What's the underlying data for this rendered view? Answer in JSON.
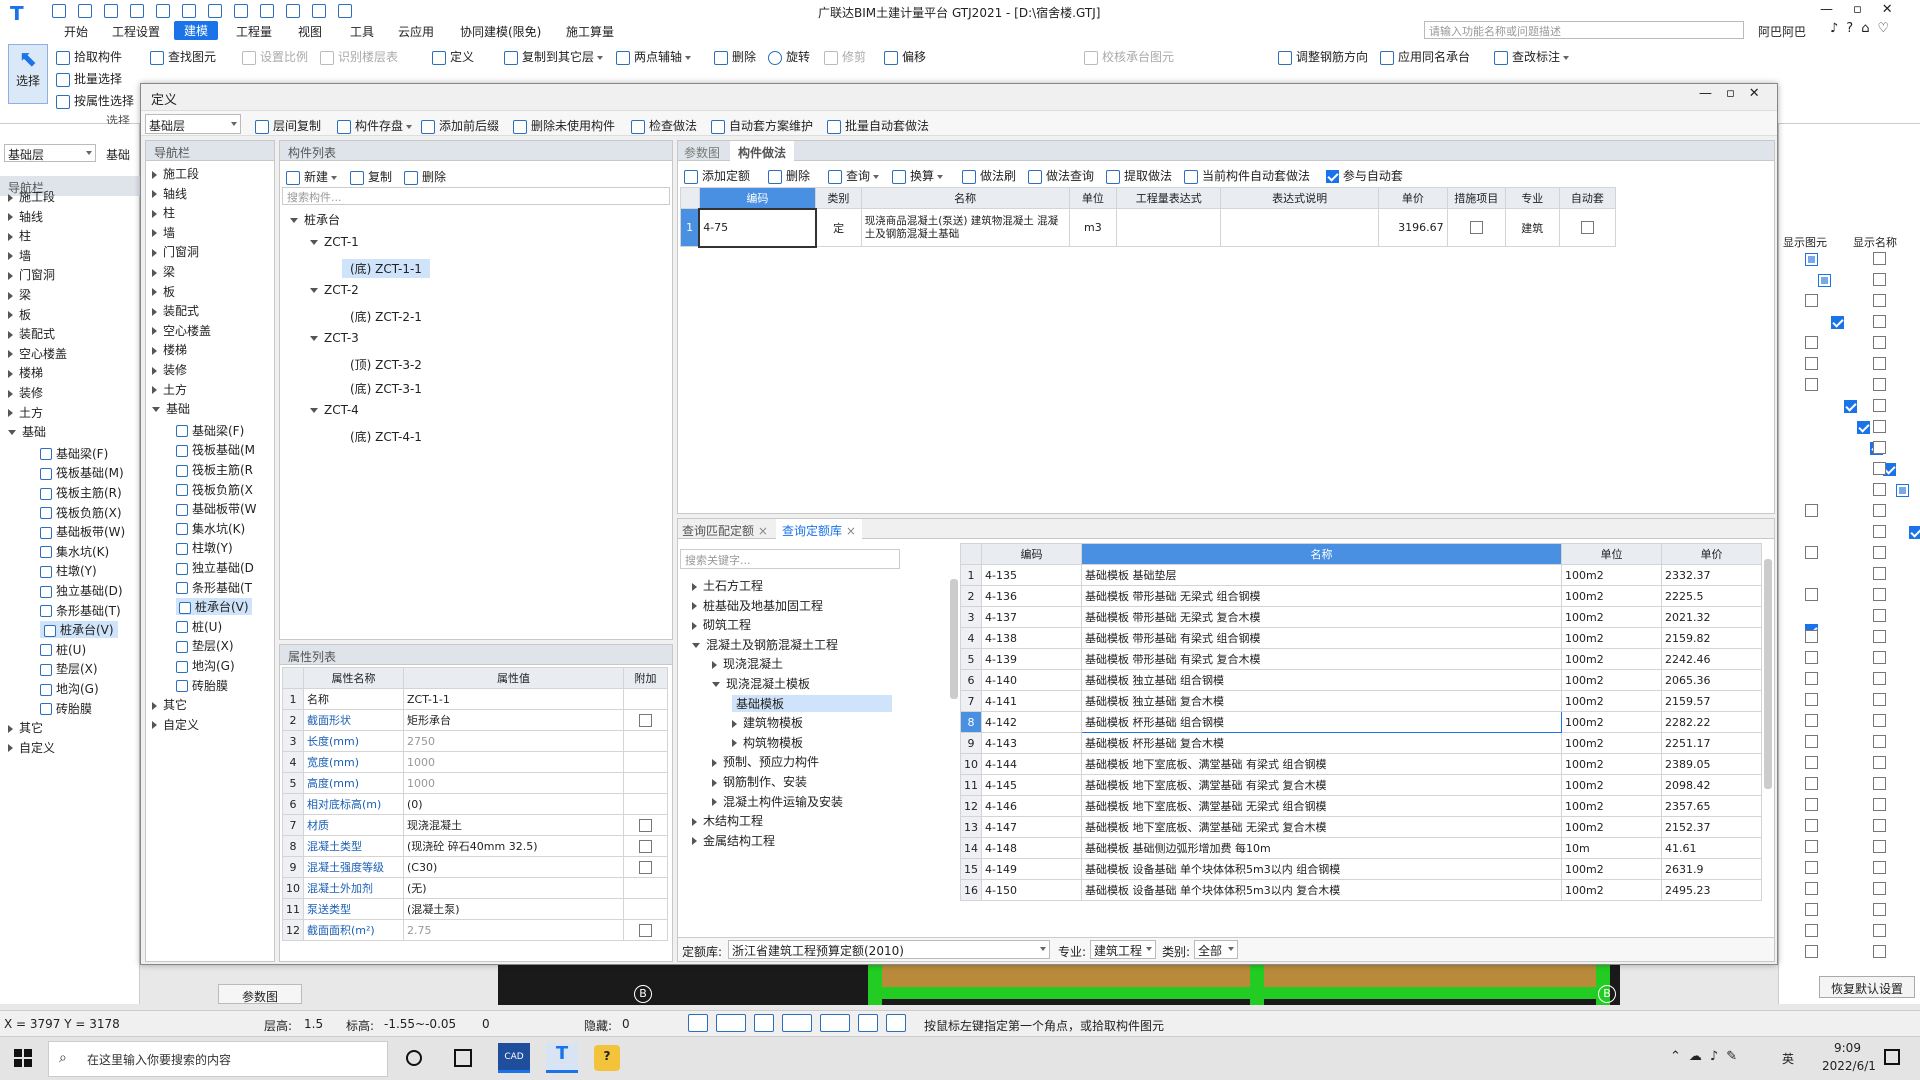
{
  "app": {
    "title": "广联达BIM土建计量平台 GTJ2021 - [D:\\宿舍楼.GTJ]",
    "search_placeholder": "请输入功能名称或问题描述",
    "user": "阿巴阿巴"
  },
  "menu": [
    "开始",
    "工程设置",
    "建模",
    "工程量",
    "视图",
    "工具",
    "云应用",
    "协同建模(限免)",
    "施工算量"
  ],
  "ribbon": {
    "select": "选择",
    "pick": "拾取构件",
    "batch": "批量选择",
    "byattr": "按属性选择",
    "find": "查找图元",
    "setscale": "设置比例",
    "idlayer": "识别楼层表",
    "define": "定义",
    "copyto": "复制到其它层",
    "twopoint": "两点辅轴",
    "delete": "删除",
    "rotate": "旋转",
    "trim": "修剪",
    "offset": "偏移",
    "checkcap": "校核承台图元",
    "adjustbar": "调整钢筋方向",
    "applysame": "应用同名承台",
    "viewmark": "查改标注",
    "group": "选择"
  },
  "left": {
    "floor": "基础层",
    "tab": "基础",
    "nav": "导航栏",
    "items": [
      "施工段",
      "轴线",
      "柱",
      "墙",
      "门窗洞",
      "梁",
      "板",
      "装配式",
      "空心楼盖",
      "楼梯",
      "装修",
      "土方",
      "基础"
    ],
    "subitems": [
      "基础梁(F)",
      "筏板基础(M)",
      "筏板主筋(R)",
      "筏板负筋(X)",
      "基础板带(W)",
      "集水坑(K)",
      "柱墩(Y)",
      "独立基础(D)",
      "条形基础(T)",
      "桩承台(V)",
      "桩(U)",
      "垫层(X)",
      "地沟(G)",
      "砖胎膜"
    ],
    "tail": [
      "其它",
      "自定义"
    ]
  },
  "dialog": {
    "title": "定义",
    "floor": "基础层",
    "toolbar": [
      "层间复制",
      "构件存盘",
      "添加前后缀",
      "删除未使用构件",
      "检查做法",
      "自动套方案维护",
      "批量自动套做法"
    ],
    "nav_title": "导航栏",
    "nav_items": [
      "施工段",
      "轴线",
      "柱",
      "墙",
      "门窗洞",
      "梁",
      "板",
      "装配式",
      "空心楼盖",
      "楼梯",
      "装修",
      "土方",
      "基础"
    ],
    "nav_sub": [
      "基础梁(F)",
      "筏板基础(M",
      "筏板主筋(R",
      "筏板负筋(X",
      "基础板带(W",
      "集水坑(K)",
      "柱墩(Y)",
      "独立基础(D",
      "条形基础(T",
      "桩承台(V)",
      "桩(U)",
      "垫层(X)",
      "地沟(G)",
      "砖胎膜"
    ],
    "nav_tail": [
      "其它",
      "自定义"
    ],
    "complist_title": "构件列表",
    "comp_new": "新建",
    "comp_copy": "复制",
    "comp_del": "删除",
    "comp_search": "搜索构件...",
    "tree": {
      "root": "桩承台",
      "groups": [
        {
          "name": "ZCT-1",
          "children": [
            "(底) ZCT-1-1"
          ]
        },
        {
          "name": "ZCT-2",
          "children": [
            "(底) ZCT-2-1"
          ]
        },
        {
          "name": "ZCT-3",
          "children": [
            "(顶) ZCT-3-2",
            "(底) ZCT-3-1"
          ]
        },
        {
          "name": "ZCT-4",
          "children": [
            "(底) ZCT-4-1"
          ]
        }
      ]
    },
    "prop_title": "属性列表",
    "prop_headers": [
      "属性名称",
      "属性值",
      "附加"
    ],
    "props": [
      [
        "名称",
        "ZCT-1-1"
      ],
      [
        "截面形状",
        "矩形承台"
      ],
      [
        "长度(mm)",
        "2750"
      ],
      [
        "宽度(mm)",
        "1000"
      ],
      [
        "高度(mm)",
        "1000"
      ],
      [
        "相对底标高(m)",
        "(0)"
      ],
      [
        "材质",
        "现浇混凝土"
      ],
      [
        "混凝土类型",
        "(现浇砼 碎石40mm 32.5)"
      ],
      [
        "混凝土强度等级",
        "(C30)"
      ],
      [
        "混凝土外加剂",
        "(无)"
      ],
      [
        "泵送类型",
        "(混凝土泵)"
      ],
      [
        "截面面积(m²)",
        "2.75"
      ]
    ],
    "tabs": [
      "参数图",
      "构件做法"
    ],
    "method_toolbar": [
      "添加定额",
      "删除",
      "查询",
      "换算",
      "做法刷",
      "做法查询",
      "提取做法",
      "当前构件自动套做法",
      "参与自动套"
    ],
    "method_headers": [
      "编码",
      "类别",
      "名称",
      "单位",
      "工程量表达式",
      "表达式说明",
      "单价",
      "措施项目",
      "专业",
      "自动套"
    ],
    "method_row": {
      "n": "1",
      "code": "4-75",
      "type": "定",
      "name": "现浇商品混凝土(泵送) 建筑物混凝土 混凝土及钢筋混凝土基础",
      "unit": "m3",
      "price": "3196.67",
      "major": "建筑"
    },
    "query_tabs": [
      "查询匹配定额",
      "查询定额库"
    ],
    "query_search": "搜索关键字...",
    "qtree": [
      "土石方工程",
      "桩基础及地基加固工程",
      "砌筑工程",
      "混凝土及钢筋混凝土工程",
      "现浇混凝土",
      "现浇混凝土模板",
      "基础模板",
      "建筑物模板",
      "构筑物模板",
      "预制、预应力构件",
      "钢筋制作、安装",
      "混凝土构件运输及安装",
      "木结构工程",
      "金属结构工程"
    ],
    "qheaders": [
      "编码",
      "名称",
      "单位",
      "单价"
    ],
    "qrows": [
      [
        "1",
        "4-135",
        "基础模板  基础垫层",
        "100m2",
        "2332.37"
      ],
      [
        "2",
        "4-136",
        "基础模板  带形基础 无梁式 组合钢模",
        "100m2",
        "2225.5"
      ],
      [
        "3",
        "4-137",
        "基础模板  带形基础 无梁式 复合木模",
        "100m2",
        "2021.32"
      ],
      [
        "4",
        "4-138",
        "基础模板  带形基础 有梁式 组合钢模",
        "100m2",
        "2159.82"
      ],
      [
        "5",
        "4-139",
        "基础模板  带形基础 有梁式 复合木模",
        "100m2",
        "2242.46"
      ],
      [
        "6",
        "4-140",
        "基础模板  独立基础 组合钢模",
        "100m2",
        "2065.36"
      ],
      [
        "7",
        "4-141",
        "基础模板  独立基础 复合木模",
        "100m2",
        "2159.57"
      ],
      [
        "8",
        "4-142",
        "基础模板  杯形基础 组合钢模",
        "100m2",
        "2282.22"
      ],
      [
        "9",
        "4-143",
        "基础模板  杯形基础 复合木模",
        "100m2",
        "2251.17"
      ],
      [
        "10",
        "4-144",
        "基础模板  地下室底板、满堂基础 有梁式 组合钢模",
        "100m2",
        "2389.05"
      ],
      [
        "11",
        "4-145",
        "基础模板  地下室底板、满堂基础 有梁式 复合木模",
        "100m2",
        "2098.42"
      ],
      [
        "12",
        "4-146",
        "基础模板  地下室底板、满堂基础 无梁式 组合钢模",
        "100m2",
        "2357.65"
      ],
      [
        "13",
        "4-147",
        "基础模板  地下室底板、满堂基础 无梁式 复合木模",
        "100m2",
        "2152.37"
      ],
      [
        "14",
        "4-148",
        "基础模板  基础侧边弧形增加费 每10m",
        "10m",
        "41.61"
      ],
      [
        "15",
        "4-149",
        "基础模板  设备基础 单个块体体积5m3以内 组合钢模",
        "100m2",
        "2631.9"
      ],
      [
        "16",
        "4-150",
        "基础模板  设备基础 单个块体体积5m3以内 复合木模",
        "100m2",
        "2495.23"
      ]
    ],
    "lib_label": "定额库:",
    "lib_value": "浙江省建筑工程预算定额(2010)",
    "major_label": "专业:",
    "major_value": "建筑工程",
    "cat_label": "类别:",
    "cat_value": "全部"
  },
  "right": {
    "col1": "显示图元",
    "col2": "显示名称",
    "reset": "恢复默认设置"
  },
  "canvas": {
    "axisB": "B"
  },
  "bottom_tab": "参数图",
  "status": {
    "coords": "X = 3797 Y = 3178",
    "floorh": "层高:",
    "floorh_v": "1.5",
    "elev": "标高:",
    "elev_v": "-1.55~-0.05",
    "zero": "0",
    "hidden": "隐藏:",
    "hidden_v": "0",
    "hint": "按鼠标左键指定第一个角点，或拾取构件图元"
  },
  "taskbar": {
    "search": "在这里输入你要搜索的内容",
    "time": "9:09",
    "date": "2022/6/1",
    "lang": "英"
  }
}
